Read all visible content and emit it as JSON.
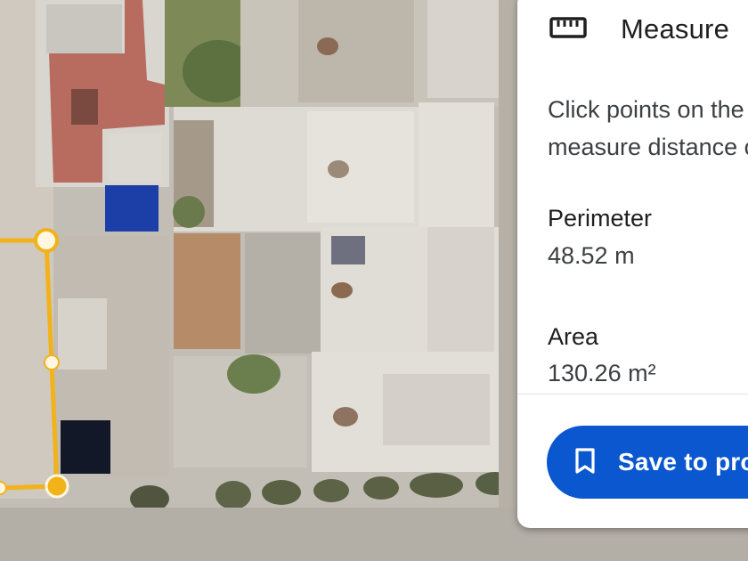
{
  "measure_panel": {
    "icon": "ruler-icon",
    "title": "Measure",
    "instructions": "Click points on the map to measure distance or area",
    "perimeter": {
      "label": "Perimeter",
      "value": "48.52 m"
    },
    "area": {
      "label": "Area",
      "value": "130.26 m²"
    },
    "save_button": {
      "icon": "bookmark-icon",
      "label": "Save to project"
    }
  },
  "map": {
    "type": "satellite",
    "measure_line_color": "#f2b21a",
    "measure_points": 4
  }
}
